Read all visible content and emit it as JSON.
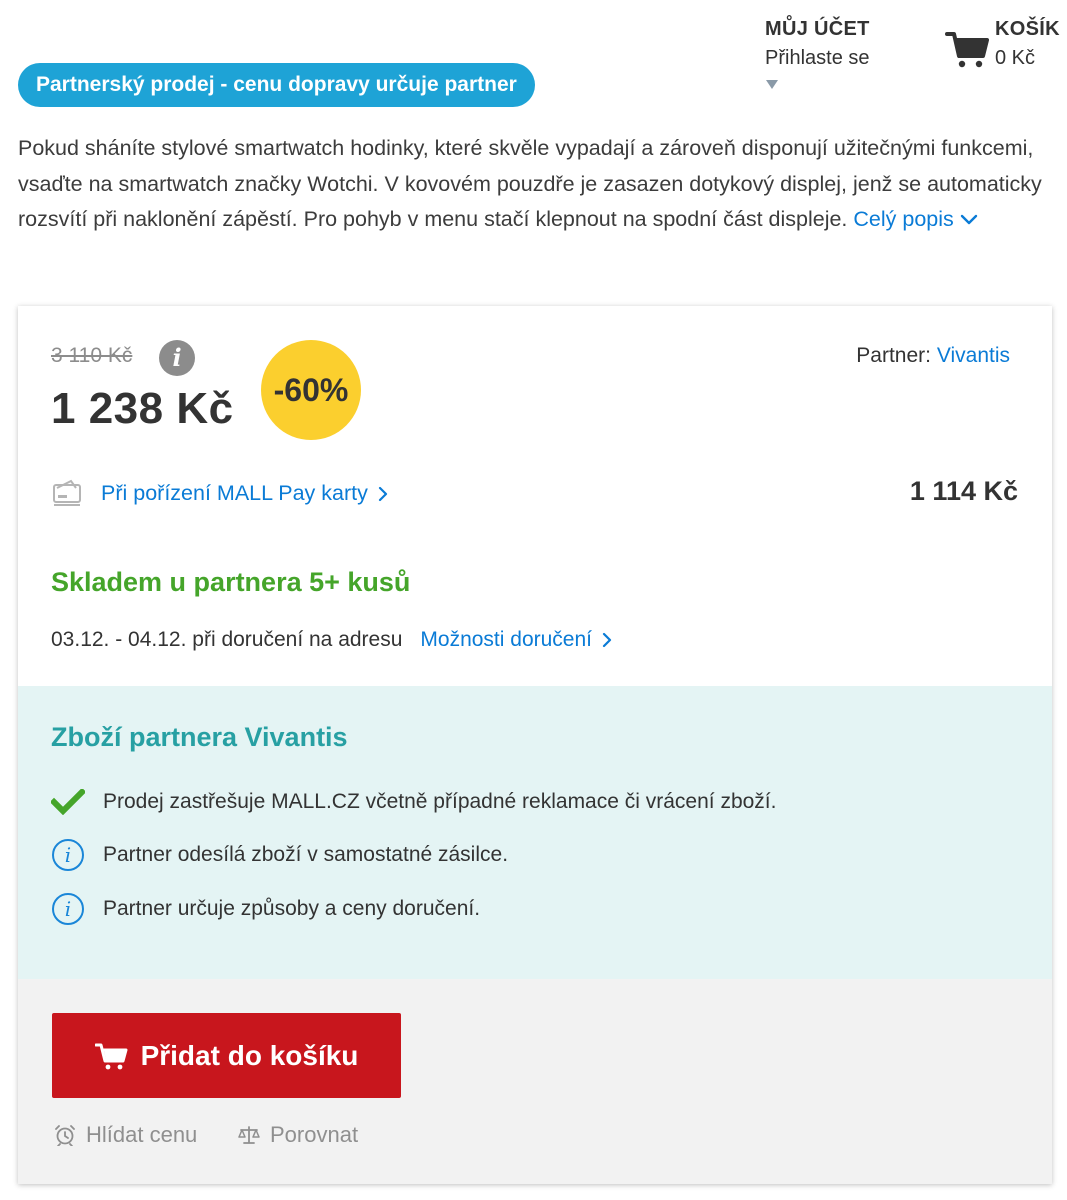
{
  "header": {
    "account_title": "MŮJ ÚČET",
    "account_login": "Přihlaste se",
    "cart_title": "KOŠÍK",
    "cart_amount": "0 Kč"
  },
  "partner_badge": "Partnerský prodej - cenu dopravy určuje partner",
  "description": {
    "text": "Pokud sháníte stylové smartwatch hodinky, které skvěle vypadají a zároveň disponují užitečnými funkcemi, vsaďte na smartwatch značky Wotchi. V kovovém pouzdře je zasazen dotykový displej, jenž se automaticky rozsvítí při naklonění zápěstí. Pro pohyb v menu stačí klepnout na spodní část displeje.",
    "more_link": "Celý popis"
  },
  "offer": {
    "old_price": "3 110 Kč",
    "price": "1 238 Kč",
    "discount": "-60%",
    "partner_label": "Partner:",
    "partner_name": "Vivantis",
    "mallpay_link": "Při pořízení MALL Pay karty",
    "mallpay_price": "1 114 Kč",
    "stock": "Skladem u partnera 5+ kusů",
    "delivery_dates": "03.12. - 04.12. při doručení na adresu",
    "delivery_link": "Možnosti doručení"
  },
  "partner_box": {
    "title": "Zboží partnera Vivantis",
    "features": [
      {
        "icon": "check-icon",
        "text": "Prodej zastřešuje MALL.CZ včetně případné reklamace či vrácení zboží."
      },
      {
        "icon": "info-icon",
        "text": "Partner odesílá zboží v samostatné zásilce."
      },
      {
        "icon": "info-icon",
        "text": "Partner určuje způsoby a ceny doručení."
      }
    ]
  },
  "actions": {
    "add_to_cart": "Přidat do košíku",
    "watch_price": "Hlídat cenu",
    "compare": "Porovnat"
  },
  "colors": {
    "brand_blue": "#1ea3d6",
    "link": "#0a7bd6",
    "stock_green": "#45a52a",
    "teal_title": "#27a0a3",
    "discount_yellow": "#fbcf2e",
    "cta_red": "#c8161d"
  }
}
